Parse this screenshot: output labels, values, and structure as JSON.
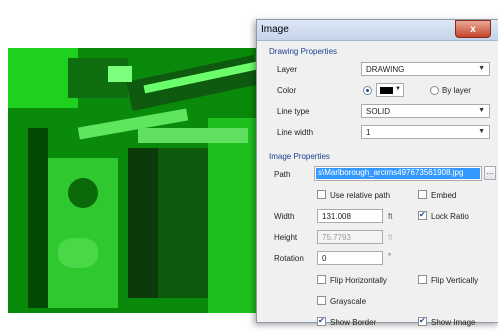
{
  "dialog": {
    "title": "Image",
    "close_label": "x"
  },
  "drawing": {
    "heading": "Drawing Properties",
    "layer_label": "Layer",
    "layer_value": "DRAWING",
    "color_label": "Color",
    "color_swatch": "#000000",
    "by_layer_label": "By layer",
    "linetype_label": "Line type",
    "linetype_value": "SOLID",
    "linewidth_label": "Line width",
    "linewidth_value": "1"
  },
  "image": {
    "heading": "Image Properties",
    "path_label": "Path",
    "path_value": "s\\Marlborough_arcims497673561908.jpg",
    "browse_label": "...",
    "relative_path_label": "Use relative path",
    "embed_label": "Embed",
    "width_label": "Width",
    "width_value": "131.008",
    "width_unit": "ft",
    "lock_ratio_label": "Lock Ratio",
    "height_label": "Height",
    "height_value": "75.7793",
    "height_unit": "ft",
    "rotation_label": "Rotation",
    "rotation_value": "0",
    "rotation_unit": "°",
    "flip_h_label": "Flip Horizontally",
    "flip_v_label": "Flip Vertically",
    "grayscale_label": "Grayscale",
    "show_border_label": "Show Border",
    "show_image_label": "Show Image"
  },
  "colors": {
    "aerial_green": "#0c7a0c",
    "section_heading": "#1c3f94",
    "selection": "#3399ff"
  }
}
